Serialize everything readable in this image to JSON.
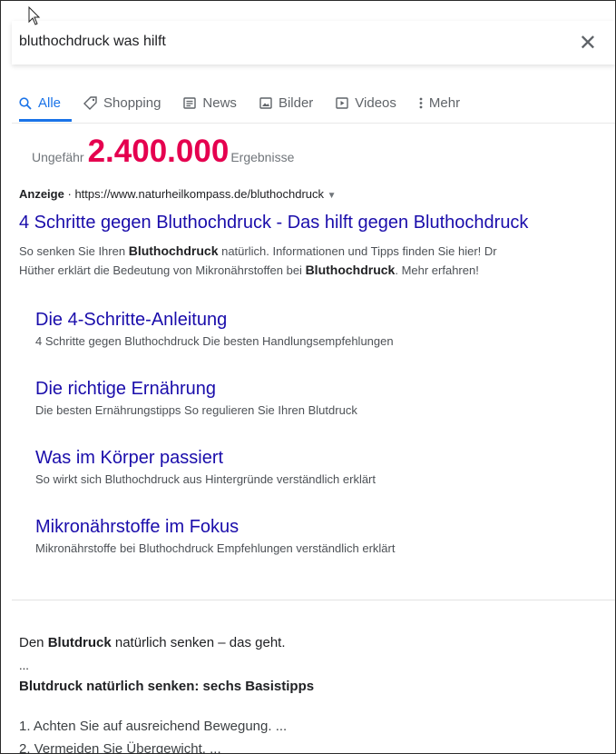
{
  "search": {
    "query": "bluthochdruck was hilft"
  },
  "tabs": [
    {
      "label": "Alle",
      "icon": "search-icon"
    },
    {
      "label": "Shopping",
      "icon": "tag-icon"
    },
    {
      "label": "News",
      "icon": "news-icon"
    },
    {
      "label": "Bilder",
      "icon": "image-icon"
    },
    {
      "label": "Videos",
      "icon": "video-icon"
    },
    {
      "label": "Mehr",
      "icon": "more-vert-icon"
    }
  ],
  "results_info": {
    "prefix": "Ungefähr",
    "count": "2.400.000",
    "suffix": "Ergebnisse"
  },
  "ad": {
    "badge": "Anzeige",
    "separator": "·",
    "url": "https://www.naturheilkompass.de/bluthochdruck",
    "title": "4 Schritte gegen Bluthochdruck - Das hilft gegen Bluthochdruck",
    "desc": {
      "p1": "So senken Sie Ihren ",
      "b1": "Bluthochdruck",
      "p2": " natürlich. Informationen und Tipps finden Sie hier! Dr",
      "p3": "Hüther erklärt die Bedeutung von Mikronährstoffen bei ",
      "b2": "Bluthochdruck",
      "p4": ". Mehr erfahren!"
    },
    "sitelinks": [
      {
        "title": "Die 4-Schritte-Anleitung",
        "desc": "4 Schritte gegen Bluthochdruck Die besten Handlungsempfehlungen"
      },
      {
        "title": "Die richtige Ernährung",
        "desc": "Die besten Ernährungstipps So regulieren Sie Ihren Blutdruck"
      },
      {
        "title": "Was im Körper passiert",
        "desc": "So wirkt sich Bluthochdruck aus Hintergründe verständlich erklärt"
      },
      {
        "title": "Mikronährstoffe im Fokus",
        "desc": "Mikronährstoffe bei Bluthochdruck Empfehlungen verständlich erklärt"
      }
    ]
  },
  "snippet": {
    "l1_b": "Blutdruck",
    "l1_rest": " natürlich senken – das geht.",
    "l1_pre": "Den ",
    "ellipsis": "...",
    "heading": "Blutdruck natürlich senken: sechs Basistipps",
    "items": [
      "1. Achten Sie auf ausreichend Bewegung. ...",
      "2. Vermeiden Sie Übergewicht. ..."
    ]
  },
  "colors": {
    "link": "#1a0dab",
    "accent": "#1a73e8",
    "count": "#e5004f"
  }
}
